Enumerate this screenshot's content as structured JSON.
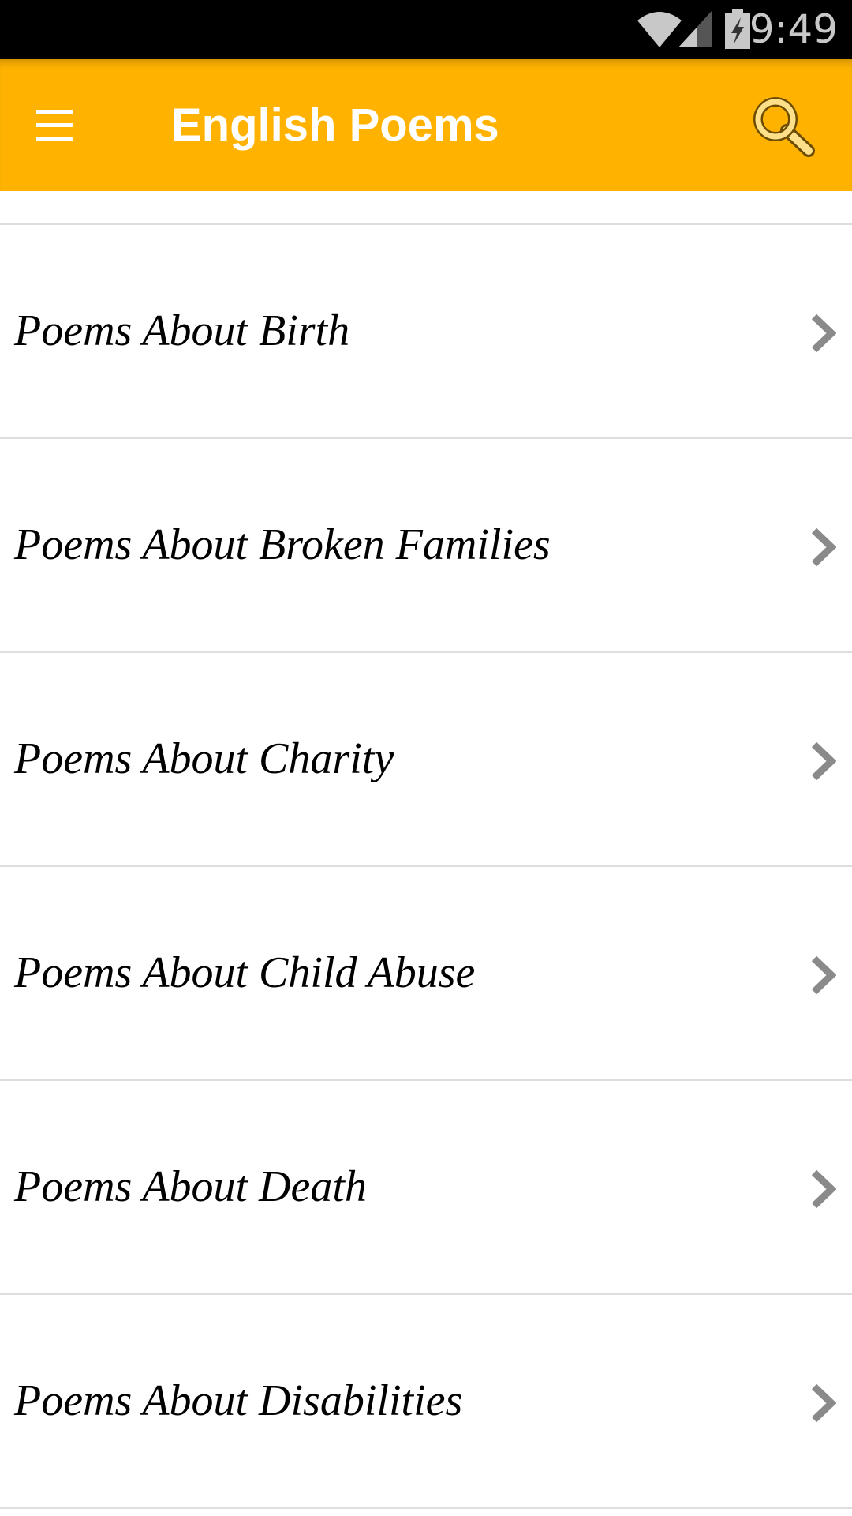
{
  "status_bar": {
    "time": "9:49",
    "icons": [
      "wifi-icon",
      "signal-icon",
      "battery-charging-icon"
    ]
  },
  "toolbar": {
    "title": "English Poems",
    "menu_icon": "hamburger-menu-icon",
    "search_icon": "search-icon",
    "color": "#ffb300"
  },
  "list": {
    "items": [
      {
        "label": "Poems About Birth"
      },
      {
        "label": "Poems About Broken Families"
      },
      {
        "label": "Poems About Charity"
      },
      {
        "label": "Poems About Child Abuse"
      },
      {
        "label": "Poems About Death"
      },
      {
        "label": "Poems About Disabilities"
      }
    ],
    "chevron_icon": "chevron-right-icon"
  }
}
